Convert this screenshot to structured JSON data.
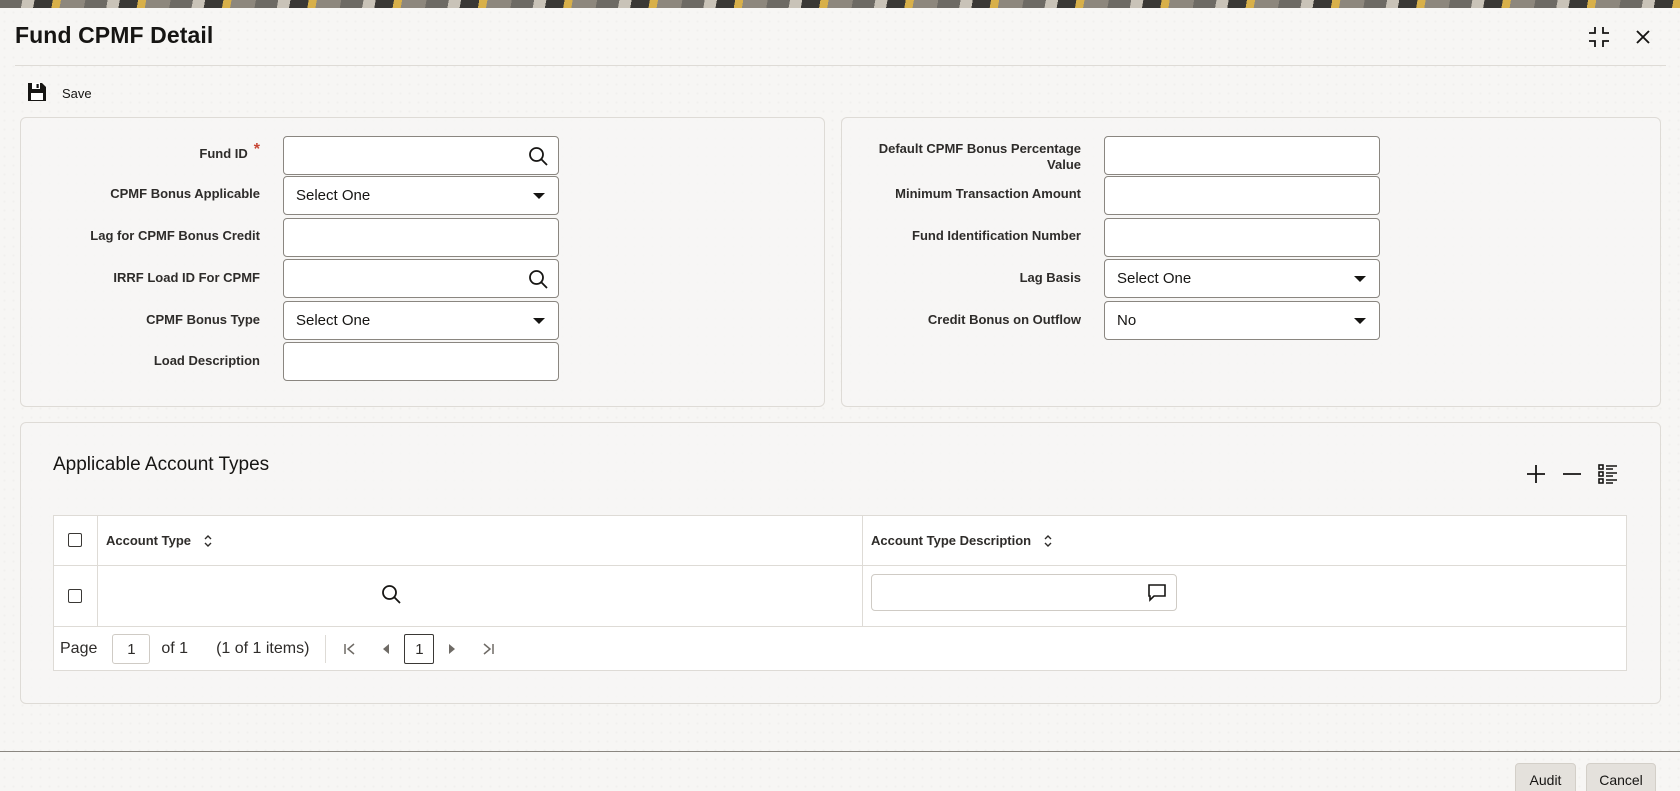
{
  "window": {
    "title": "Fund CPMF Detail",
    "maximize_icon": "minimize-arrows-icon",
    "close_icon": "close-icon"
  },
  "toolbar": {
    "save_label": "Save",
    "save_icon": "floppy-disk-icon"
  },
  "left_form": {
    "fund_id": {
      "label": "Fund ID",
      "required_mark": "*",
      "value": ""
    },
    "cpmf_bonus_applicable": {
      "label": "CPMF Bonus Applicable",
      "value": "Select One"
    },
    "lag_for_cpmf_bonus_credit": {
      "label": "Lag for CPMF Bonus Credit",
      "value": ""
    },
    "irrf_load_id": {
      "label": "IRRF Load ID For CPMF",
      "value": ""
    },
    "cpmf_bonus_type": {
      "label": "CPMF Bonus Type",
      "value": "Select One"
    },
    "load_description": {
      "label": "Load Description",
      "value": ""
    }
  },
  "right_form": {
    "default_bonus_pct_line1": "Default CPMF Bonus Percentage",
    "default_bonus_pct_line2": "Value",
    "default_bonus_pct_value": "",
    "min_transaction_amount": {
      "label": "Minimum Transaction Amount",
      "value": ""
    },
    "fund_identification_number": {
      "label": "Fund Identification Number",
      "value": ""
    },
    "lag_basis": {
      "label": "Lag Basis",
      "value": "Select One"
    },
    "credit_bonus_on_outflow": {
      "label": "Credit Bonus on Outflow",
      "value": "No"
    }
  },
  "account_types": {
    "title": "Applicable Account Types",
    "columns": [
      "Account Type",
      "Account Type Description"
    ],
    "rows": [
      {
        "account_type": "",
        "description": ""
      }
    ],
    "pager": {
      "page_label": "Page",
      "current_page": "1",
      "of_label": "of 1",
      "items_label": "(1 of 1 items)",
      "current_page_button": "1"
    }
  },
  "footer": {
    "audit_label": "Audit",
    "cancel_label": "Cancel"
  }
}
